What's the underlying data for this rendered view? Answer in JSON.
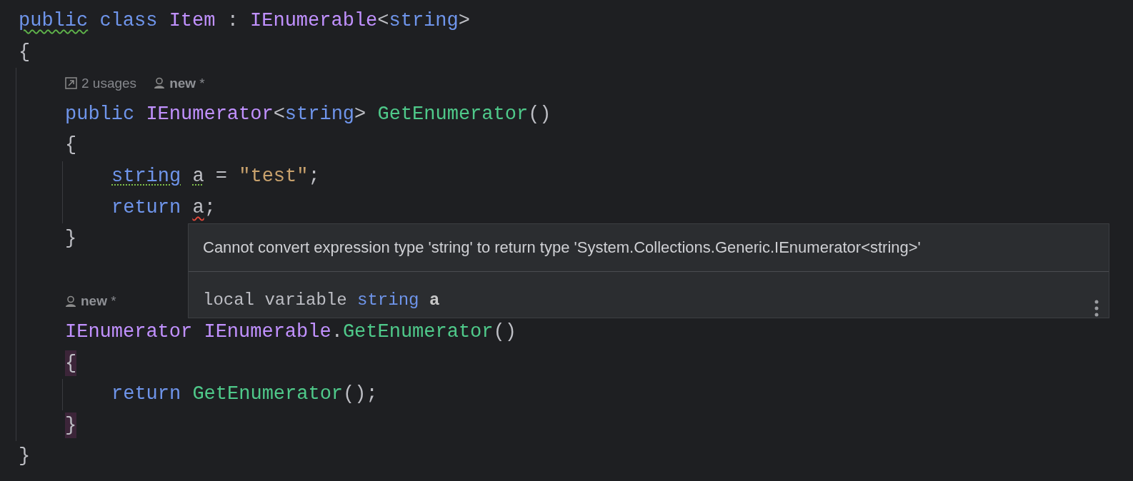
{
  "editor": {
    "lines": [
      {
        "tokens": [
          {
            "text": "public ",
            "kind": "keyword",
            "warning": true,
            "suggestion": false,
            "error": false
          },
          {
            "text": "class ",
            "kind": "keyword",
            "warning": false,
            "suggestion": false,
            "error": false
          },
          {
            "text": "Item",
            "kind": "type",
            "warning": false,
            "suggestion": false,
            "error": false
          },
          {
            "text": " : ",
            "kind": "plain",
            "warning": false,
            "suggestion": false,
            "error": false
          },
          {
            "text": "IEnumerable",
            "kind": "type",
            "warning": false,
            "suggestion": false,
            "error": false
          },
          {
            "text": "<",
            "kind": "plain",
            "warning": false,
            "suggestion": false,
            "error": false
          },
          {
            "text": "string",
            "kind": "keyword",
            "warning": false,
            "suggestion": false,
            "error": false
          },
          {
            "text": ">",
            "kind": "plain",
            "warning": false,
            "suggestion": false,
            "error": false
          }
        ]
      },
      {
        "tokens": [
          {
            "text": "{",
            "kind": "plain",
            "warning": false,
            "suggestion": false,
            "error": false
          }
        ],
        "highlighted": false
      },
      {
        "children": [
          {
            "kind": "inlay",
            "hints": [
              {
                "kind": "usages",
                "text": "2 usages"
              },
              {
                "kind": "author",
                "text": "**new** *"
              }
            ]
          },
          {
            "tokens": [
              {
                "text": "public ",
                "kind": "keyword",
                "warning": false,
                "suggestion": false,
                "error": false
              },
              {
                "text": "IEnumerator",
                "kind": "type",
                "warning": false,
                "suggestion": false,
                "error": false
              },
              {
                "text": "<",
                "kind": "plain",
                "warning": false,
                "suggestion": false,
                "error": false
              },
              {
                "text": "string",
                "kind": "keyword",
                "warning": false,
                "suggestion": false,
                "error": false
              },
              {
                "text": "> ",
                "kind": "plain",
                "warning": false,
                "suggestion": false,
                "error": false
              },
              {
                "text": "GetEnumerator",
                "kind": "method",
                "warning": false,
                "suggestion": false,
                "error": false
              },
              {
                "text": "()",
                "kind": "plain",
                "warning": false,
                "suggestion": false,
                "error": false
              }
            ]
          },
          {
            "tokens": [
              {
                "text": "{",
                "kind": "plain",
                "warning": false,
                "suggestion": false,
                "error": false
              }
            ],
            "highlighted": false
          },
          {
            "children": [
              {
                "tokens": [
                  {
                    "text": "string ",
                    "kind": "keyword",
                    "warning": false,
                    "suggestion": true,
                    "error": false
                  },
                  {
                    "text": "a",
                    "kind": "plain",
                    "warning": false,
                    "suggestion": true,
                    "error": false
                  },
                  {
                    "text": " = ",
                    "kind": "plain",
                    "warning": false,
                    "suggestion": false,
                    "error": false
                  },
                  {
                    "text": "\"test\"",
                    "kind": "string",
                    "warning": false,
                    "suggestion": false,
                    "error": false
                  },
                  {
                    "text": ";",
                    "kind": "plain",
                    "warning": false,
                    "suggestion": false,
                    "error": false
                  }
                ]
              },
              {
                "tokens": [
                  {
                    "text": "return ",
                    "kind": "keyword",
                    "warning": false,
                    "suggestion": false,
                    "error": false
                  },
                  {
                    "text": "a",
                    "kind": "plain",
                    "warning": false,
                    "suggestion": false,
                    "error": true
                  },
                  {
                    "text": ";",
                    "kind": "plain",
                    "warning": false,
                    "suggestion": false,
                    "error": false
                  }
                ]
              }
            ]
          },
          {
            "tokens": [
              {
                "text": "}",
                "kind": "plain",
                "warning": false,
                "suggestion": false,
                "error": false
              }
            ],
            "highlighted": false
          },
          {
            "kind": "blank"
          },
          {
            "kind": "inlay",
            "hints": [
              {
                "kind": "author",
                "text": "**new** *"
              }
            ]
          },
          {
            "tokens": [
              {
                "text": "IEnumerator ",
                "kind": "type",
                "warning": false,
                "suggestion": false,
                "error": false
              },
              {
                "text": "IEnumerable",
                "kind": "type",
                "warning": false,
                "suggestion": false,
                "error": false
              },
              {
                "text": ".",
                "kind": "plain",
                "warning": false,
                "suggestion": false,
                "error": false
              },
              {
                "text": "GetEnumerator",
                "kind": "method",
                "warning": false,
                "suggestion": false,
                "error": false
              },
              {
                "text": "()",
                "kind": "plain",
                "warning": false,
                "suggestion": false,
                "error": false
              }
            ]
          },
          {
            "tokens": [
              {
                "text": "{",
                "kind": "plain",
                "warning": false,
                "suggestion": false,
                "error": false
              }
            ],
            "highlighted": true
          },
          {
            "children": [
              {
                "tokens": [
                  {
                    "text": "return ",
                    "kind": "keyword",
                    "warning": false,
                    "suggestion": false,
                    "error": false
                  },
                  {
                    "text": "GetEnumerator",
                    "kind": "method",
                    "warning": false,
                    "suggestion": false,
                    "error": false
                  },
                  {
                    "text": "();",
                    "kind": "plain",
                    "warning": false,
                    "suggestion": false,
                    "error": false
                  }
                ]
              }
            ]
          },
          {
            "tokens": [
              {
                "text": "}",
                "kind": "plain",
                "warning": false,
                "suggestion": false,
                "error": false
              }
            ],
            "highlighted": true
          }
        ]
      },
      {
        "tokens": [
          {
            "text": "}",
            "kind": "plain",
            "warning": false,
            "suggestion": false,
            "error": false
          }
        ],
        "highlighted": false
      }
    ]
  },
  "tooltip": {
    "message": "Cannot convert expression type 'string' to return type 'System.Collections.Generic.IEnumerator<string>'",
    "signature": [
      {
        "text": "local variable ",
        "kind": "plain"
      },
      {
        "text": "string ",
        "kind": "keyword"
      },
      {
        "text": "a",
        "kind": "identifier"
      }
    ]
  }
}
